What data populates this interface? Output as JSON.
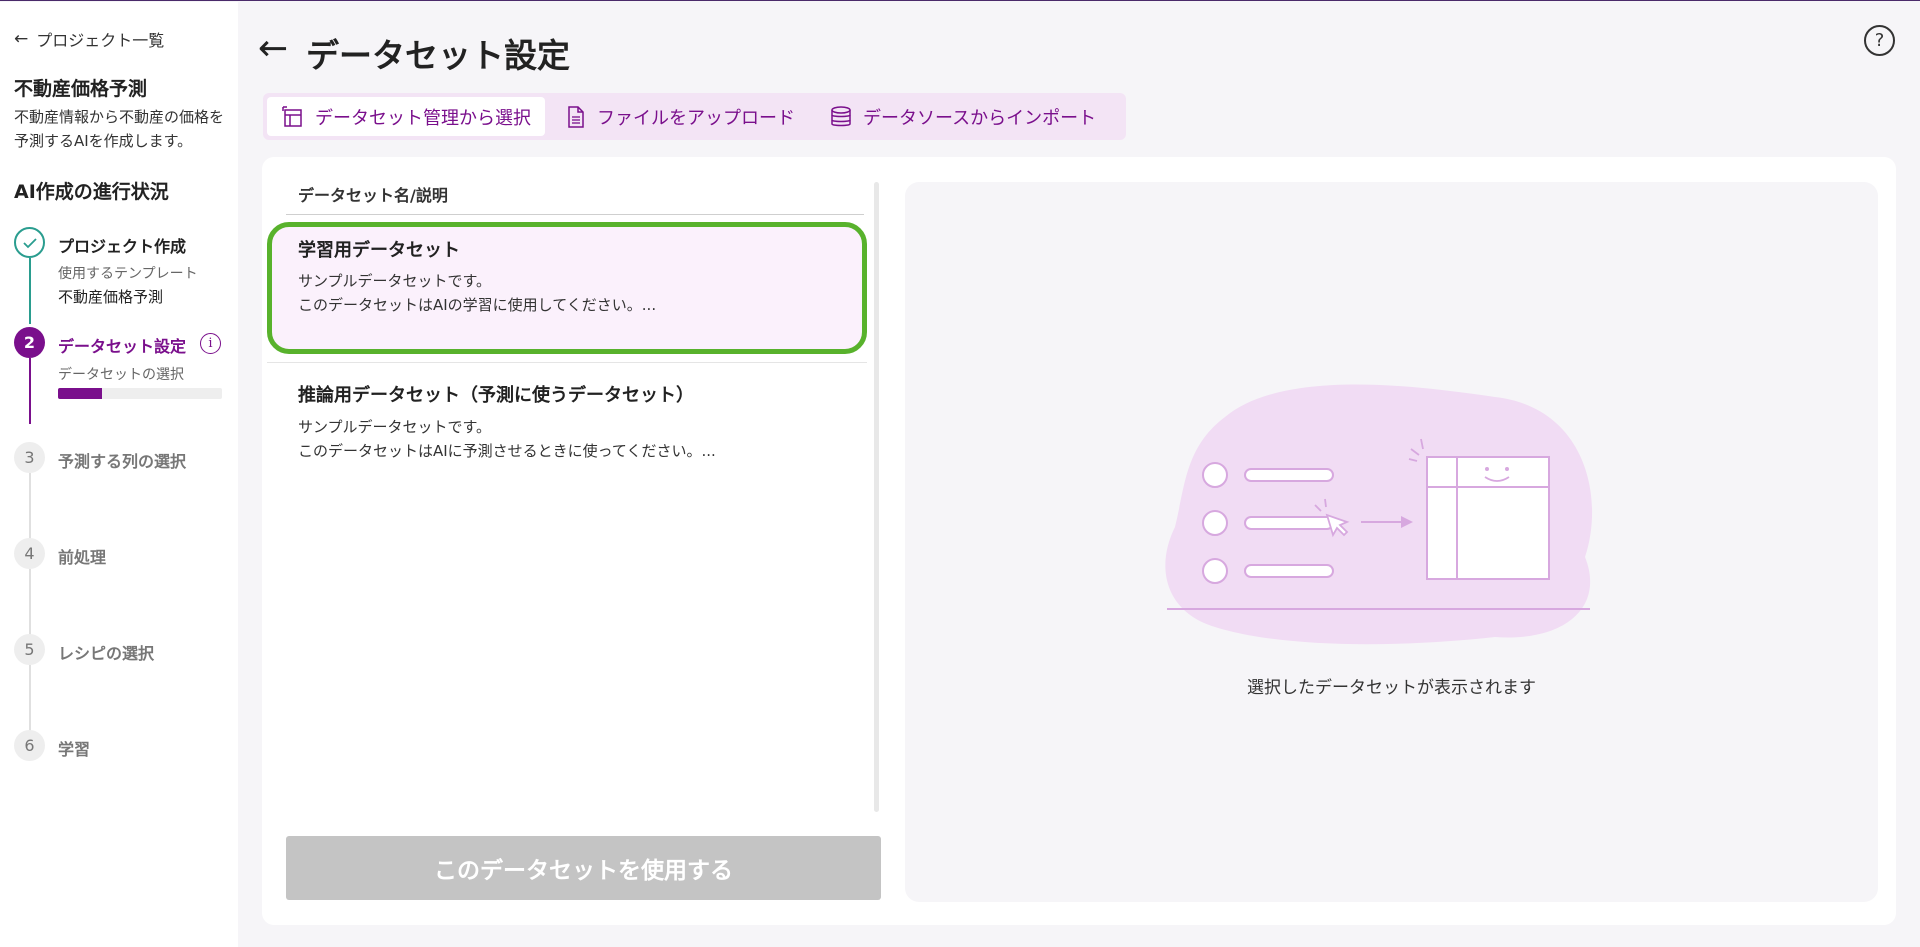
{
  "sidebar": {
    "back_label": "プロジェクト一覧",
    "project_title": "不動産価格予測",
    "project_description": "不動産情報から不動産の価格を予測するAIを作成します。",
    "progress_title": "AI作成の進行状況",
    "steps": [
      {
        "number": "✓",
        "label": "プロジェクト作成",
        "sub_label": "使用するテンプレート",
        "sub_value": "不動産価格予測",
        "status": "done"
      },
      {
        "number": "2",
        "label": "データセット設定",
        "sub_label": "データセットの選択",
        "status": "active",
        "progress": 0.27
      },
      {
        "number": "3",
        "label": "予測する列の選択",
        "status": "todo"
      },
      {
        "number": "4",
        "label": "前処理",
        "status": "todo"
      },
      {
        "number": "5",
        "label": "レシピの選択",
        "status": "todo"
      },
      {
        "number": "6",
        "label": "学習",
        "status": "todo"
      }
    ]
  },
  "header": {
    "title": "データセット設定",
    "help_icon": "?"
  },
  "tabs": [
    {
      "label": "データセット管理から選択",
      "icon": "dataset-manage-icon",
      "active": true
    },
    {
      "label": "ファイルをアップロード",
      "icon": "file-icon",
      "active": false
    },
    {
      "label": "データソースからインポート",
      "icon": "database-icon",
      "active": false
    }
  ],
  "list": {
    "column_header": "データセット名/説明",
    "items": [
      {
        "name": "学習用データセット",
        "desc_line1": "サンプルデータセットです。",
        "desc_line2": "このデータセットはAIの学習に使用してください。...",
        "selected": true
      },
      {
        "name": "推論用データセット（予測に使うデータセット）",
        "desc_line1": "サンプルデータセットです。",
        "desc_line2": "このデータセットはAIに予測させるときに使ってください。...",
        "selected": false
      }
    ]
  },
  "use_button_label": "このデータセットを使用する",
  "preview": {
    "empty_text": "選択したデータセットが表示されます"
  },
  "colors": {
    "accent": "#7a0f8c",
    "done": "#2a9d8f",
    "selected_border": "#58b22c",
    "tab_bg": "#f3e4f5",
    "illustration": "#d7a8df"
  }
}
